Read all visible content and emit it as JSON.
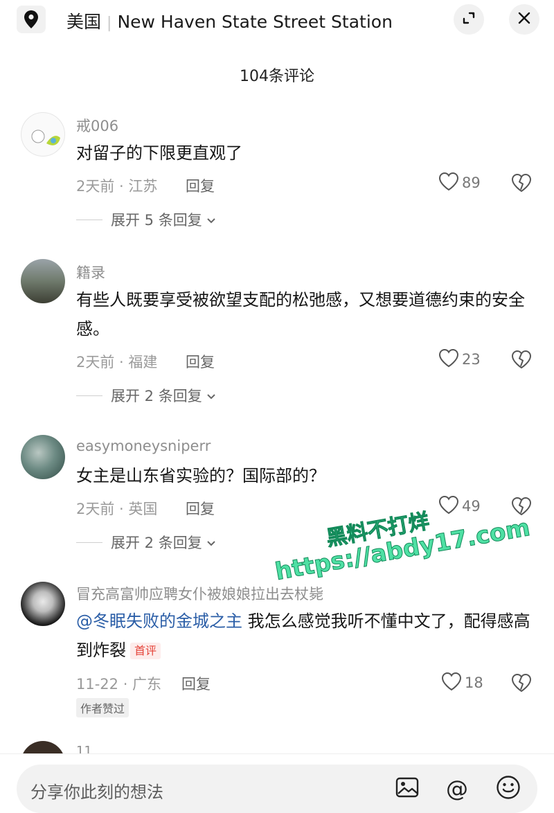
{
  "header": {
    "country": "美国",
    "location": "New Haven State Street Station",
    "collapse_icon": "collapse-icon",
    "close_icon": "close-icon"
  },
  "comment_count": "104条评论",
  "comments": [
    {
      "username": "戒006",
      "text": "对留子的下限更直观了",
      "time_region": "2天前 · 江苏",
      "reply_label": "回复",
      "likes": "89",
      "expand_label": "展开 5 条回复"
    },
    {
      "username": "籍录",
      "text": "有些人既要享受被欲望支配的松弛感，又想要道德约束的安全感。",
      "time_region": "2天前 · 福建",
      "reply_label": "回复",
      "likes": "23",
      "expand_label": "展开 2 条回复"
    },
    {
      "username": "easymoneysniperr",
      "text": "女主是山东省实验的？国际部的？",
      "time_region": "2天前 · 英国",
      "reply_label": "回复",
      "likes": "49",
      "expand_label": "展开 2 条回复"
    },
    {
      "username": "冒充高富帅应聘女仆被娘娘拉出去杖毙",
      "mention": "@冬眠失败的金城之主",
      "text": " 我怎么感觉我听不懂中文了，配得感高到炸裂",
      "first_tag": "首评",
      "time_region": "11-22 · 广东",
      "reply_label": "回复",
      "likes": "18",
      "author_badge": "作者赞过"
    },
    {
      "username": "11"
    }
  ],
  "watermark": {
    "line1": "黑料不打烊",
    "line2": "https://abdy17.com"
  },
  "input": {
    "placeholder": "分享你此刻的想法"
  },
  "colors": {
    "mention": "#2b5ea7",
    "first_tag": "#e5443a",
    "watermark": "#4fe0a4"
  }
}
